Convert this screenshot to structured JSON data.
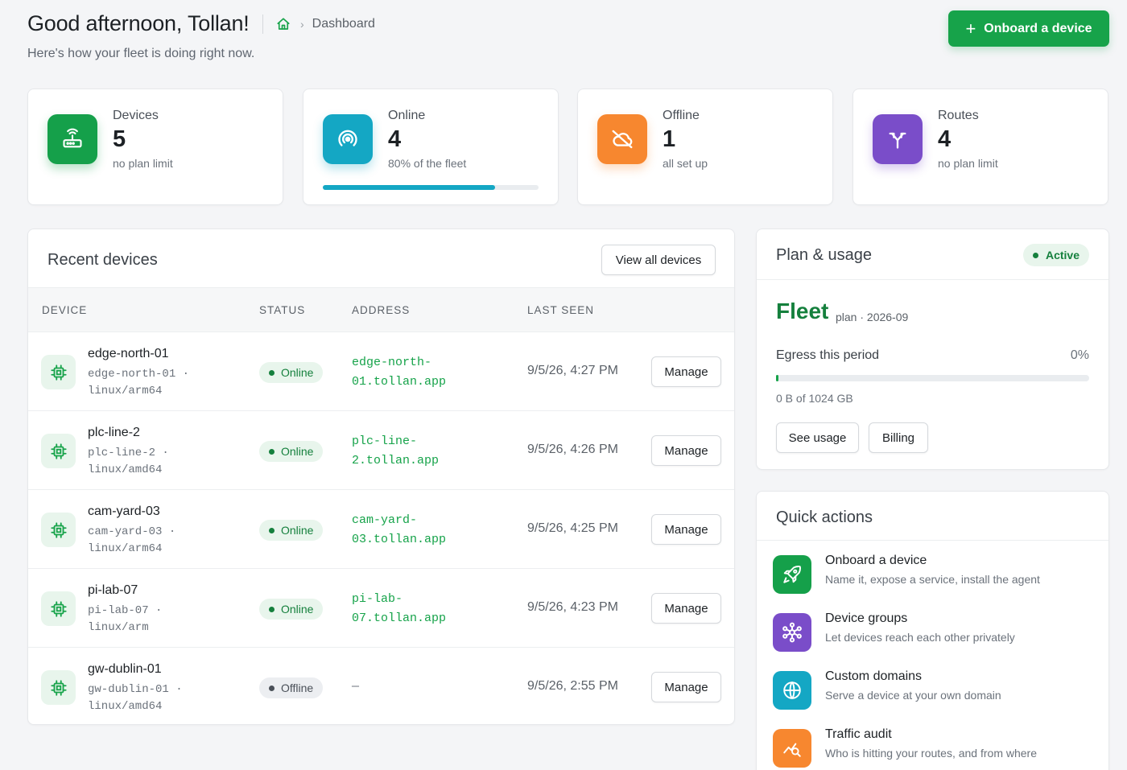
{
  "header": {
    "greeting": "Good afternoon, Tollan!",
    "breadcrumb_page": "Dashboard",
    "subtitle": "Here's how your fleet is doing right now.",
    "primary_action": "Onboard a device"
  },
  "stats": [
    {
      "label": "Devices",
      "value": "5",
      "note": "no plan limit",
      "icon": "router-icon",
      "color": "#15a04a"
    },
    {
      "label": "Online",
      "value": "4",
      "note": "80% of the fleet",
      "icon": "signal-icon",
      "color": "#14a7c4",
      "progress": 0.8
    },
    {
      "label": "Offline",
      "value": "1",
      "note": "all set up",
      "icon": "cloud-off-icon",
      "color": "#f7872f"
    },
    {
      "label": "Routes",
      "value": "4",
      "note": "no plan limit",
      "icon": "fork-icon",
      "color": "#7a4dc9"
    }
  ],
  "recent": {
    "title": "Recent devices",
    "view_all": "View all devices",
    "columns": [
      "DEVICE",
      "STATUS",
      "ADDRESS",
      "LAST SEEN"
    ],
    "rows": [
      {
        "name": "edge-north-01",
        "meta": "edge-north-01 · linux/arm64",
        "status": "Online",
        "address": "edge-north-01.tollan.app",
        "seen": "9/5/26, 4:27 PM",
        "action": "Manage"
      },
      {
        "name": "plc-line-2",
        "meta": "plc-line-2 · linux/amd64",
        "status": "Online",
        "address": "plc-line-2.tollan.app",
        "seen": "9/5/26, 4:26 PM",
        "action": "Manage"
      },
      {
        "name": "cam-yard-03",
        "meta": "cam-yard-03 · linux/arm64",
        "status": "Online",
        "address": "cam-yard-03.tollan.app",
        "seen": "9/5/26, 4:25 PM",
        "action": "Manage"
      },
      {
        "name": "pi-lab-07",
        "meta": "pi-lab-07 · linux/arm",
        "status": "Online",
        "address": "pi-lab-07.tollan.app",
        "seen": "9/5/26, 4:23 PM",
        "action": "Manage"
      },
      {
        "name": "gw-dublin-01",
        "meta": "gw-dublin-01 · linux/amd64",
        "status": "Offline",
        "address": "—",
        "seen": "9/5/26, 2:55 PM",
        "action": "Manage"
      }
    ]
  },
  "plan": {
    "title": "Plan & usage",
    "status": "Active",
    "name": "Fleet",
    "sub": "plan · 2026-09",
    "egress_label": "Egress this period",
    "egress_pct": "0%",
    "egress_fraction": 0.0,
    "egress_note": "0 B of 1024 GB",
    "see_usage": "See usage",
    "billing": "Billing"
  },
  "quick": {
    "title": "Quick actions",
    "items": [
      {
        "title": "Onboard a device",
        "desc": "Name it, expose a service, install the agent",
        "icon": "rocket-icon",
        "color": "#15a04a"
      },
      {
        "title": "Device groups",
        "desc": "Let devices reach each other privately",
        "icon": "network-icon",
        "color": "#7a4dc9"
      },
      {
        "title": "Custom domains",
        "desc": "Serve a device at your own domain",
        "icon": "globe-icon",
        "color": "#14a7c4"
      },
      {
        "title": "Traffic audit",
        "desc": "Who is hitting your routes, and from where",
        "icon": "audit-icon",
        "color": "#f7872f"
      }
    ]
  }
}
